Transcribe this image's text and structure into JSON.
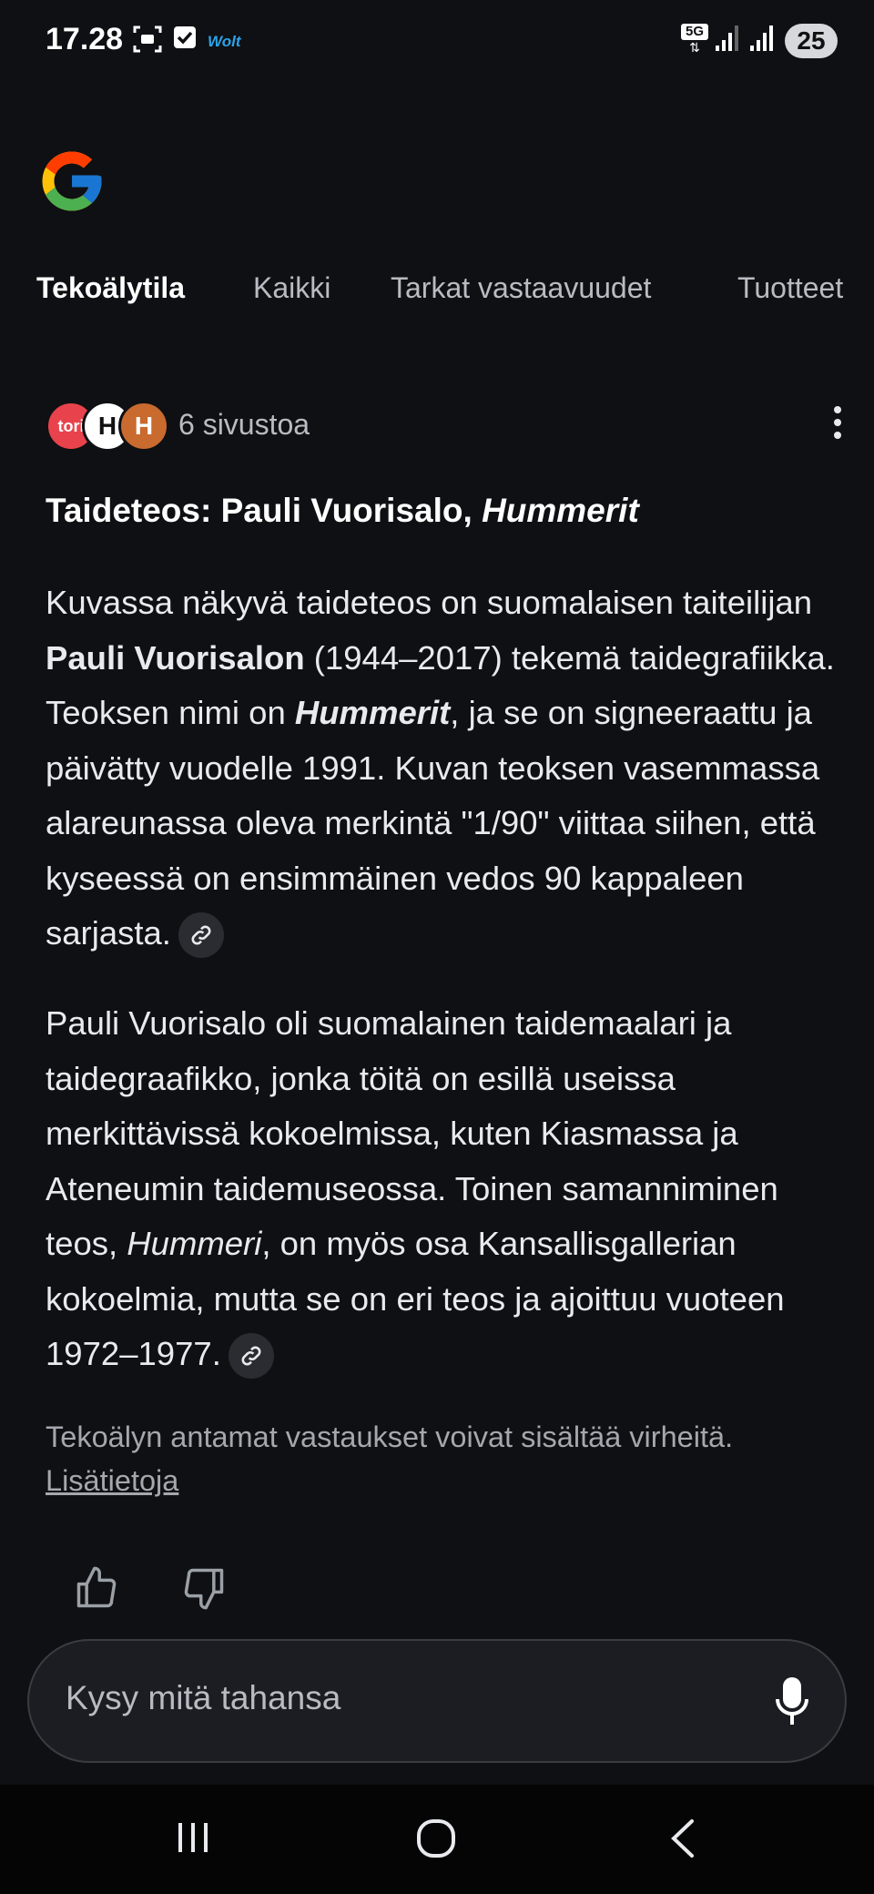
{
  "status": {
    "time": "17.28",
    "app_label": "Wolt",
    "network": "5G",
    "battery": "25"
  },
  "tabs": [
    {
      "label": "Tekoälytila",
      "active": true
    },
    {
      "label": "Kaikki"
    },
    {
      "label": "Tarkat vastaavuudet"
    },
    {
      "label": "Tuotteet"
    }
  ],
  "sources": {
    "label": "6 sivustoa",
    "favicons": [
      "tori",
      "H",
      "H"
    ]
  },
  "answer": {
    "title_prefix": "Taideteos: Pauli Vuorisalo, ",
    "title_work": "Hummerit",
    "p1": {
      "t1": "Kuvassa näkyvä taideteos on suomalaisen taiteilijan ",
      "artist": "Pauli Vuorisalon",
      "t2": " (1944–2017) tekemä taidegrafiikka. Teoksen nimi on ",
      "work": "Hummerit",
      "t3": ", ja se on signeeraattu ja päivätty vuodelle 1991. Kuvan teoksen vasemmassa alareunassa oleva merkintä \"1/90\" viittaa siihen, että kyseessä on ensimmäinen vedos 90 kappaleen sarjasta."
    },
    "p2": {
      "t1": "Pauli Vuorisalo oli suomalainen taidemaalari ja taidegraafikko, jonka töitä on esillä useissa merkittävissä kokoelmissa, kuten Kiasmassa ja Ateneumin taidemuseossa. Toinen samanniminen teos, ",
      "work": "Hummeri",
      "t2": ", on myös osa Kansallisgallerian kokoelmia, mutta se on eri teos ja ajoittuu vuoteen 1972–1977."
    }
  },
  "disclaimer": {
    "text": "Tekoälyn antamat vastaukset voivat sisältää virheitä. ",
    "link": "Lisätietoja"
  },
  "ask": {
    "placeholder": "Kysy mitä tahansa"
  },
  "colors": {
    "background": "#0f1013",
    "tori_red": "#e8434c",
    "askbar": "#1c1d22"
  }
}
